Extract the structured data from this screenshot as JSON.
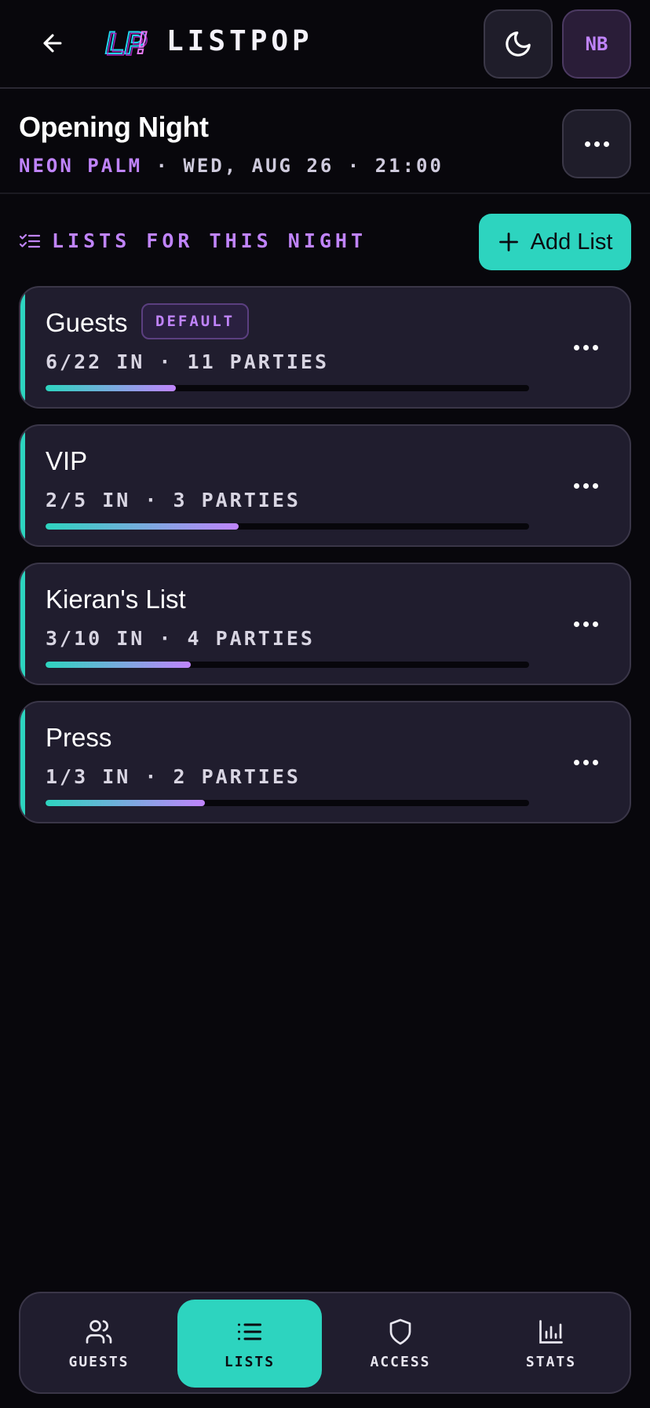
{
  "header": {
    "brand": "LISTPOP",
    "logo_text": "LP!",
    "back_icon": "arrow-left-icon",
    "theme_icon": "moon-icon",
    "avatar_initials": "NB"
  },
  "event": {
    "title": "Opening Night",
    "venue": "NEON PALM",
    "details": "· WED, AUG 26 · 21:00"
  },
  "section": {
    "label": "LISTS FOR THIS NIGHT",
    "icon": "checklist-icon",
    "add_label": "Add List"
  },
  "lists": [
    {
      "name": "Guests",
      "badge": "DEFAULT",
      "stats": "6/22 IN · 11 PARTIES",
      "progress": 0.27
    },
    {
      "name": "VIP",
      "badge": "",
      "stats": "2/5 IN · 3 PARTIES",
      "progress": 0.4
    },
    {
      "name": "Kieran's List",
      "badge": "",
      "stats": "3/10 IN · 4 PARTIES",
      "progress": 0.3
    },
    {
      "name": "Press",
      "badge": "",
      "stats": "1/3 IN · 2 PARTIES",
      "progress": 0.33
    }
  ],
  "nav": {
    "items": [
      {
        "label": "GUESTS",
        "icon": "users-icon",
        "active": false
      },
      {
        "label": "LISTS",
        "icon": "list-icon",
        "active": true
      },
      {
        "label": "ACCESS",
        "icon": "shield-icon",
        "active": false
      },
      {
        "label": "STATS",
        "icon": "bar-chart-icon",
        "active": false
      }
    ]
  },
  "colors": {
    "accent": "#2dd4bf",
    "purple": "#c084fc",
    "background": "#08070c",
    "card": "#201d2e"
  }
}
